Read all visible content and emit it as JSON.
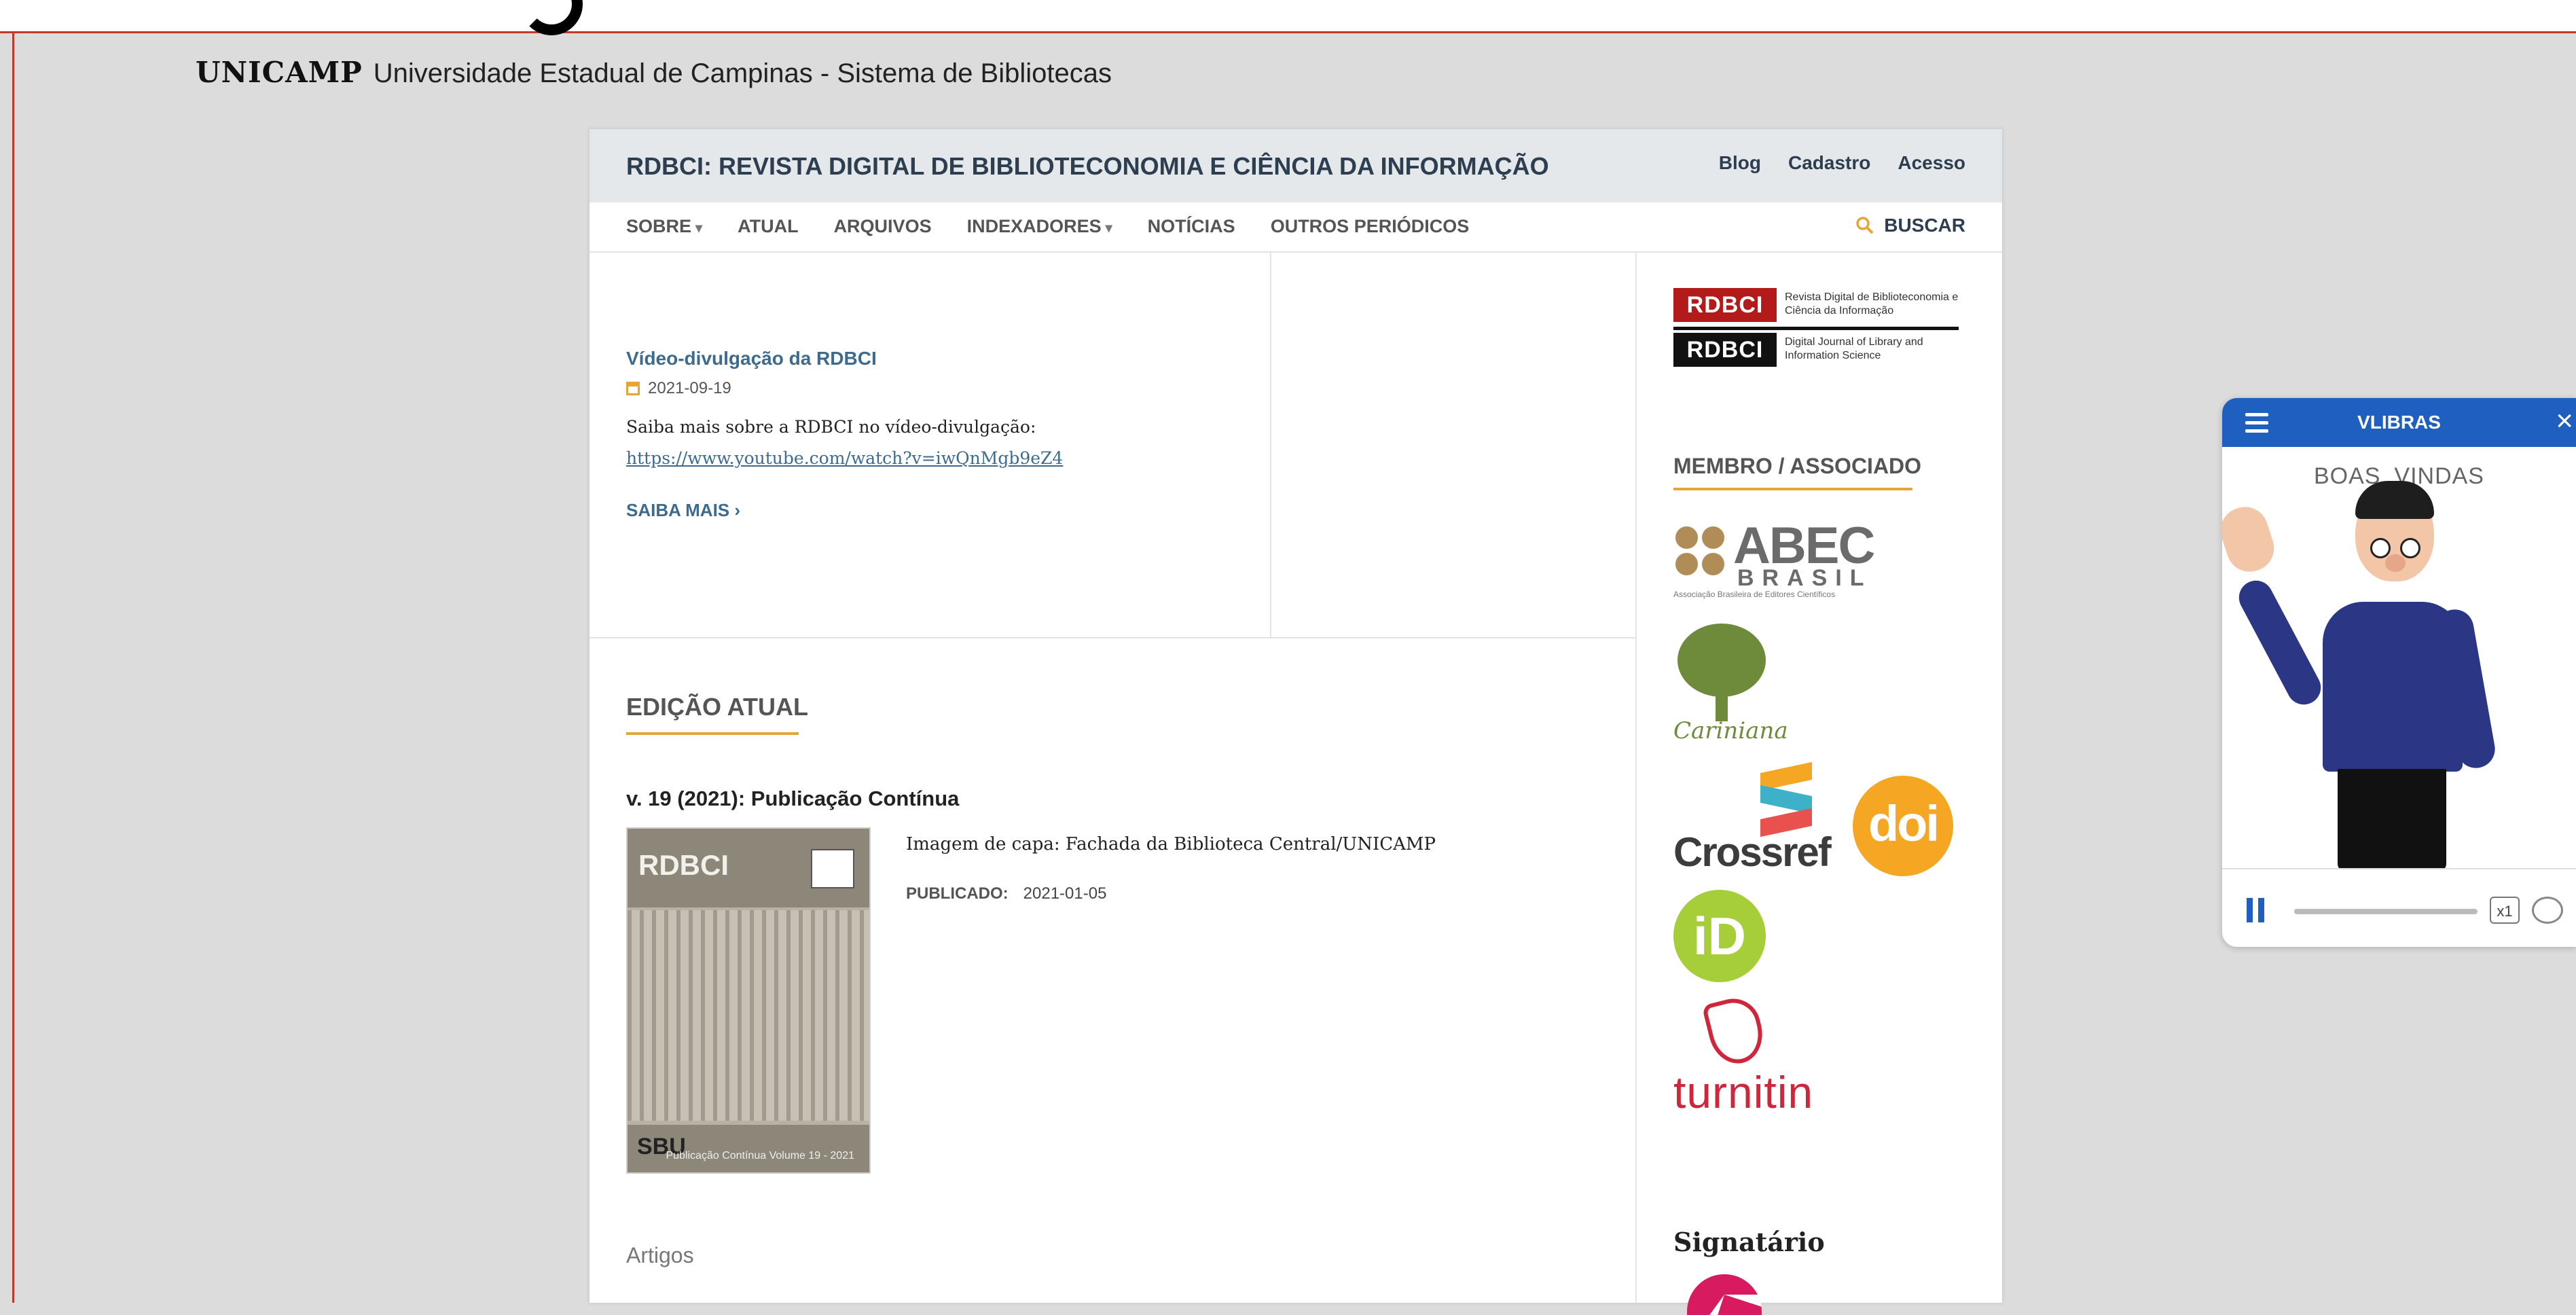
{
  "unicamp": {
    "logo": "UNICAMP",
    "subtitle": "Universidade Estadual de Campinas - Sistema de Bibliotecas"
  },
  "header": {
    "title": "RDBCI: REVISTA DIGITAL DE BIBLIOTECONOMIA E CIÊNCIA DA INFORMAÇÃO",
    "links": [
      "Blog",
      "Cadastro",
      "Acesso"
    ]
  },
  "nav": {
    "items": [
      "SOBRE",
      "ATUAL",
      "ARQUIVOS",
      "INDEXADORES",
      "NOTÍCIAS",
      "OUTROS PERIÓDICOS"
    ],
    "search": "BUSCAR"
  },
  "news": {
    "title": "Vídeo-divulgação da RDBCI",
    "date": "2021-09-19",
    "body": "Saiba mais sobre a RDBCI no vídeo-divulgação: ",
    "link": "https://www.youtube.com/watch?v=iwQnMgb9eZ4",
    "more": "SAIBA MAIS"
  },
  "edition": {
    "heading": "EDIÇÃO ATUAL",
    "issue": "v. 19 (2021): Publicação Contínua",
    "cover_caption": "Imagem de capa: Fachada da Biblioteca Central/UNICAMP",
    "published_label": "PUBLICADO:",
    "published_date": "2021-01-05",
    "section": "Artigos"
  },
  "cover": {
    "title": "RDBCI",
    "footer_logo": "SBU",
    "footer_text": "Publicação Contínua Volume 19 - 2021"
  },
  "sidebar": {
    "rdbci_logo": {
      "pt": "RDBCI",
      "pt_text": "Revista Digital de Biblioteconomia e Ciência da Informação",
      "en": "RDBCI",
      "en_text": "Digital Journal of Library and Information Science"
    },
    "membro_heading": "MEMBRO / ASSOCIADO",
    "abec": {
      "word": "ABEC",
      "country": "BRASIL",
      "caption": "Associação Brasileira de Editores Científicos"
    },
    "cariniana": "Cariniana",
    "crossref": "Crossref",
    "doi": "doi",
    "orcid": "iD",
    "turnitin": "turnitin",
    "signatario": "Signatário"
  },
  "vlibras": {
    "title": "VLIBRAS",
    "word": "BOAS_VINDAS",
    "speed": "x1"
  },
  "colors": {
    "accent": "#e5a637",
    "link": "#3d6b8f",
    "vlibras_blue": "#1f5fbf",
    "rdbci_red": "#b31b1b"
  }
}
